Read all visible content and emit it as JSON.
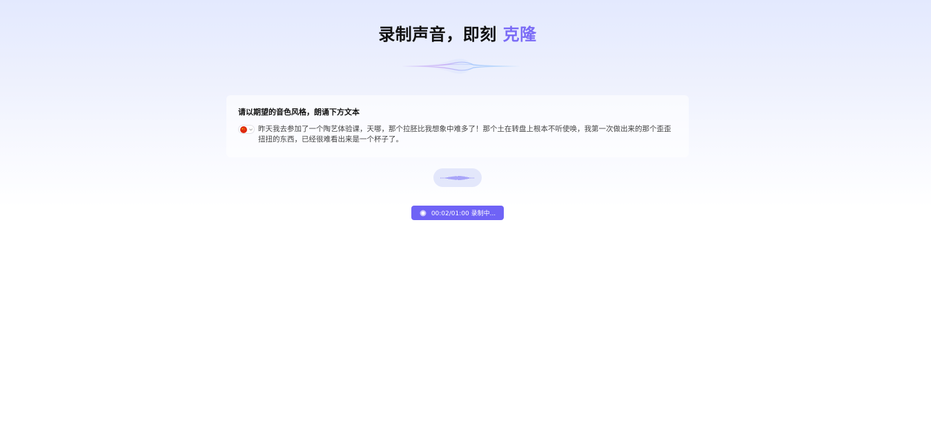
{
  "header": {
    "title_main": "录制声音，即刻 ",
    "title_accent": "克隆"
  },
  "prompt_card": {
    "heading": "请以期望的音色风格，朗诵下方文本",
    "language_flag": "china-flag-icon",
    "text": "昨天我去参加了一个陶艺体验课，天哪，那个拉胚比我想象中难多了！那个土在转盘上根本不听使唤，我第一次做出来的那个歪歪扭扭的东西，已经很难看出来是一个杯子了。"
  },
  "recorder": {
    "status_icon": "record-icon",
    "time_elapsed": "00:02",
    "time_total": "01:00",
    "status_label": "00:02/01:00 录制中..."
  },
  "colors": {
    "accent": "#7b6cf6",
    "button": "#6f63f6",
    "pill_bg": "#e3e7fb",
    "bg_top": "#e3e9fe",
    "bg_bottom": "#ffffff"
  }
}
